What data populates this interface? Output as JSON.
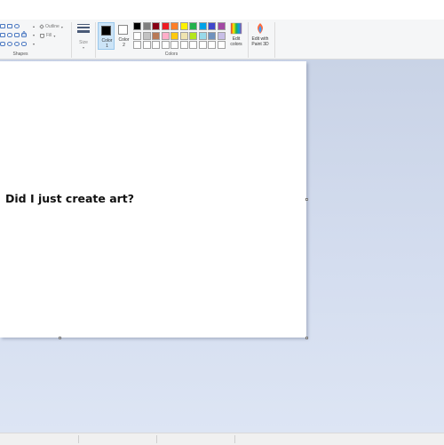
{
  "ribbon": {
    "groups": {
      "shapes_label": "Shapes",
      "colors_label": "Colors"
    },
    "shapes": {
      "outline_label": "Outline",
      "fill_label": "Fill"
    },
    "size_label": "Size",
    "color1": {
      "label_line1": "Color",
      "label_line2": "1",
      "color": "#000000"
    },
    "color2": {
      "label_line1": "Color",
      "label_line2": "2",
      "color": "#ffffff"
    },
    "edit_colors": {
      "line1": "Edit",
      "line2": "colors"
    },
    "edit_paint3d": {
      "line1": "Edit with",
      "line2": "Paint 3D"
    },
    "palette_row1": [
      "#000000",
      "#7f7f7f",
      "#880015",
      "#ed1c24",
      "#ff7f27",
      "#fff200",
      "#22b14c",
      "#00a2e8",
      "#3f48cc",
      "#a349a4"
    ],
    "palette_row2": [
      "#ffffff",
      "#c3c3c3",
      "#b97a57",
      "#ffaec9",
      "#ffc90e",
      "#efe4b0",
      "#b5e61d",
      "#99d9ea",
      "#7092be",
      "#c8bfe7"
    ],
    "palette_row3": [
      "#ffffff",
      "#ffffff",
      "#ffffff",
      "#ffffff",
      "#ffffff",
      "#ffffff",
      "#ffffff",
      "#ffffff",
      "#ffffff",
      "#ffffff"
    ]
  },
  "canvas": {
    "text": "Did I just create art?"
  },
  "theme": {
    "accent": "#0078d7",
    "workspace_bg": "#cfd8ea"
  }
}
